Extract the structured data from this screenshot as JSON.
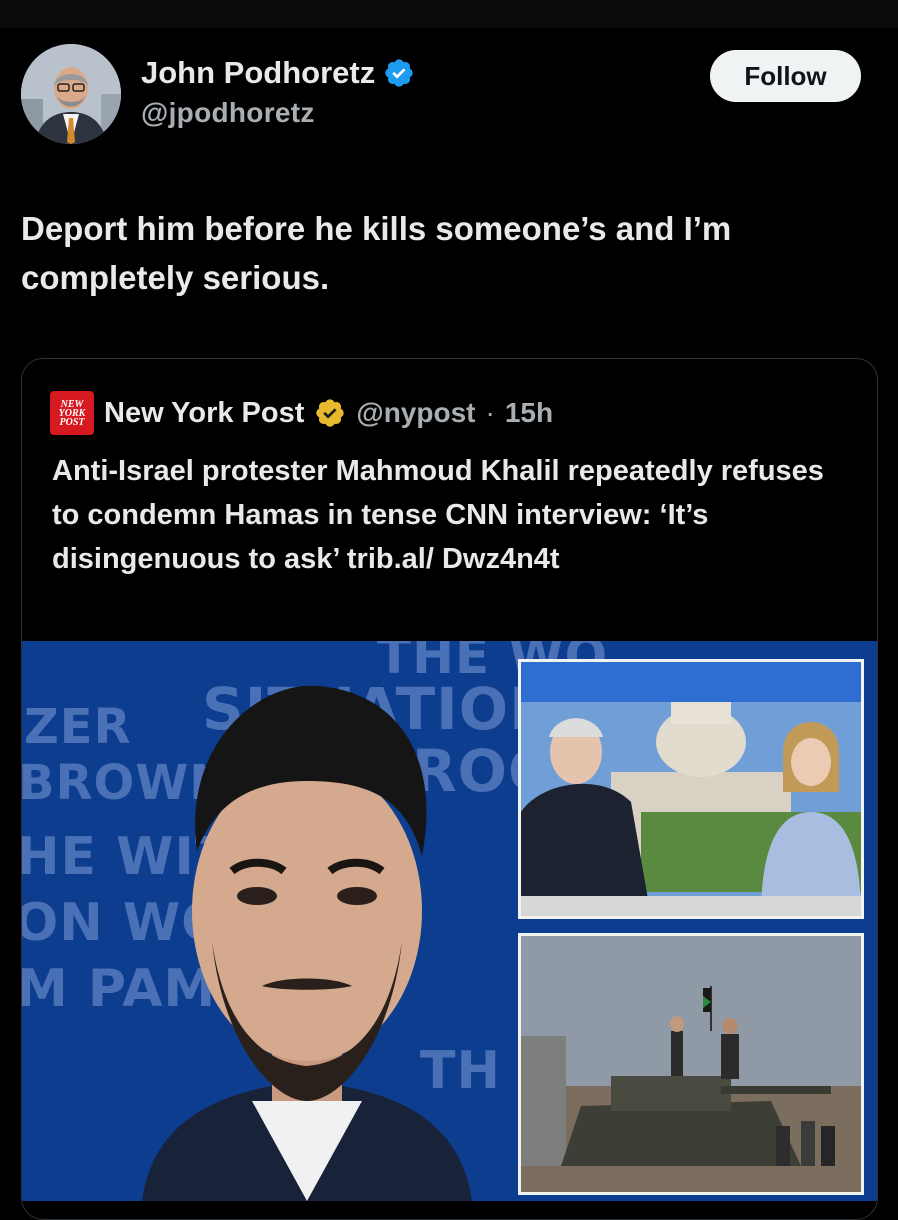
{
  "tweet": {
    "author": {
      "display_name": "John Podhoretz",
      "handle": "@jpodhoretz",
      "verified": true,
      "verified_color": "#1d9bf0"
    },
    "follow_label": "Follow",
    "text": "Deport him before he kills someone’s and I’m completely serious."
  },
  "quote": {
    "logo_lines": [
      "NEW",
      "YORK",
      "POST"
    ],
    "name": "New York Post",
    "verified_color": "#e8b82e",
    "handle": "@nypost",
    "separator": "·",
    "time": "15h",
    "text": "Anti-Israel protester Mahmoud Khalil repeatedly refuses to condemn Hamas in tense CNN interview: ‘It’s disingenuous to ask’ trib.al/ Dwz4n4t",
    "image": {
      "background_lettering": [
        "THE WO",
        "SITUATION",
        "ROOM",
        "ZER",
        "BROWN",
        "HE WIT",
        "ON WO",
        "M PAM",
        "TH"
      ]
    }
  },
  "icons": {
    "avatar": "profile-photo",
    "verified": "verified-badge-icon",
    "quote_logo": "nypost-logo"
  }
}
